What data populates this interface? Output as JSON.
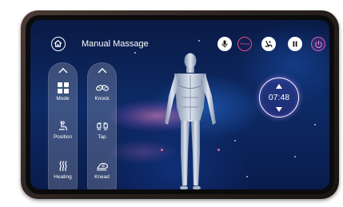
{
  "header": {
    "title": "Manual Massage",
    "record_label": "Record"
  },
  "left_panel": {
    "items": [
      {
        "label": "Mode",
        "icon": "grid-icon"
      },
      {
        "label": "Position",
        "icon": "massage-chair-icon"
      },
      {
        "label": "Heating",
        "icon": "heat-waves-icon"
      }
    ]
  },
  "right_panel": {
    "items": [
      {
        "label": "Knock",
        "icon": "knock-hands-icon"
      },
      {
        "label": "Tap",
        "icon": "tap-hands-icon"
      },
      {
        "label": "Knead",
        "icon": "knead-hand-icon"
      }
    ]
  },
  "timer": {
    "value": "07:48"
  },
  "colors": {
    "accent_pink": "#e94b8e",
    "power_magenta": "#d65ab6",
    "screen_blue": "#0d2a66"
  }
}
